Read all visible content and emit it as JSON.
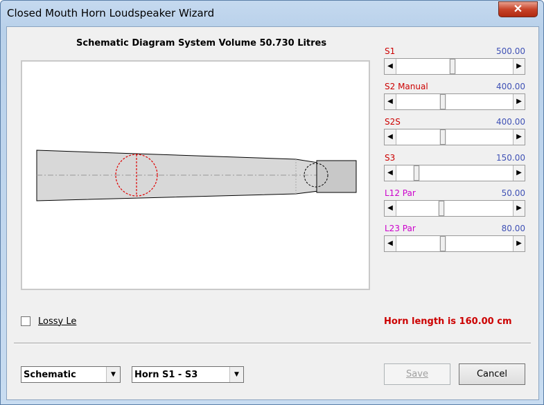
{
  "window": {
    "title": "Closed Mouth Horn Loudspeaker Wizard",
    "close_glyph": "✕"
  },
  "diagram": {
    "title": "Schematic Diagram   System Volume 50.730 Litres"
  },
  "params": [
    {
      "label": "S1",
      "value": "500.00",
      "label_color": "#cc0000",
      "level": 0.5
    },
    {
      "label": "S2  Manual",
      "value": "400.00",
      "label_color": "#cc0000",
      "level": 0.4
    },
    {
      "label": "S2S",
      "value": "400.00",
      "label_color": "#cc0000",
      "level": 0.4
    },
    {
      "label": "S3",
      "value": "150.00",
      "label_color": "#cc0000",
      "level": 0.15
    },
    {
      "label": "L12  Par",
      "value": "50.00",
      "label_color": "#cc00cc",
      "level": 0.4
    },
    {
      "label": "L23  Par",
      "value": "80.00",
      "label_color": "#cc00cc",
      "level": 0.4
    }
  ],
  "arrows": {
    "left": "◀",
    "right": "▶",
    "down": "▼"
  },
  "options": {
    "lossy_label": "Lossy Le",
    "lossy_checked": false
  },
  "status": {
    "horn_length": "Horn length is 160.00 cm"
  },
  "view_select": {
    "value": "Schematic"
  },
  "horn_select": {
    "value": "Horn S1 - S3"
  },
  "buttons": {
    "save": "Save",
    "cancel": "Cancel"
  },
  "colors": {
    "value_text": "#3f51b5",
    "status": "#cc0000"
  }
}
